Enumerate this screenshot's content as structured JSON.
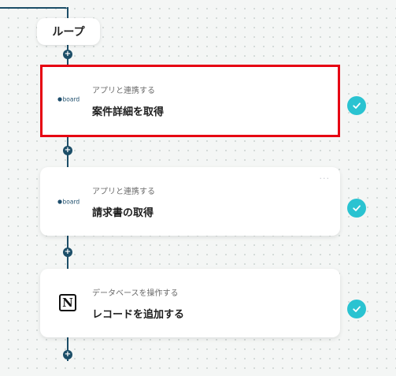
{
  "loop": {
    "label": "ループ"
  },
  "steps": [
    {
      "subtitle": "アプリと連携する",
      "title": "案件詳細を取得",
      "app_icon": "board-logo-icon",
      "selected": true,
      "status": "completed"
    },
    {
      "subtitle": "アプリと連携する",
      "title": "請求書の取得",
      "app_icon": "board-logo-icon",
      "selected": false,
      "status": "completed",
      "menu": "···"
    },
    {
      "subtitle": "データベースを操作する",
      "title": "レコードを追加する",
      "app_icon": "notion-logo-icon",
      "app_icon_letter": "N",
      "selected": false,
      "status": "completed"
    }
  ],
  "add_button": {
    "glyph": "+"
  },
  "colors": {
    "flow_line": "#1c4e68",
    "selection_border": "#e60012",
    "check": "#2ac3d1"
  }
}
